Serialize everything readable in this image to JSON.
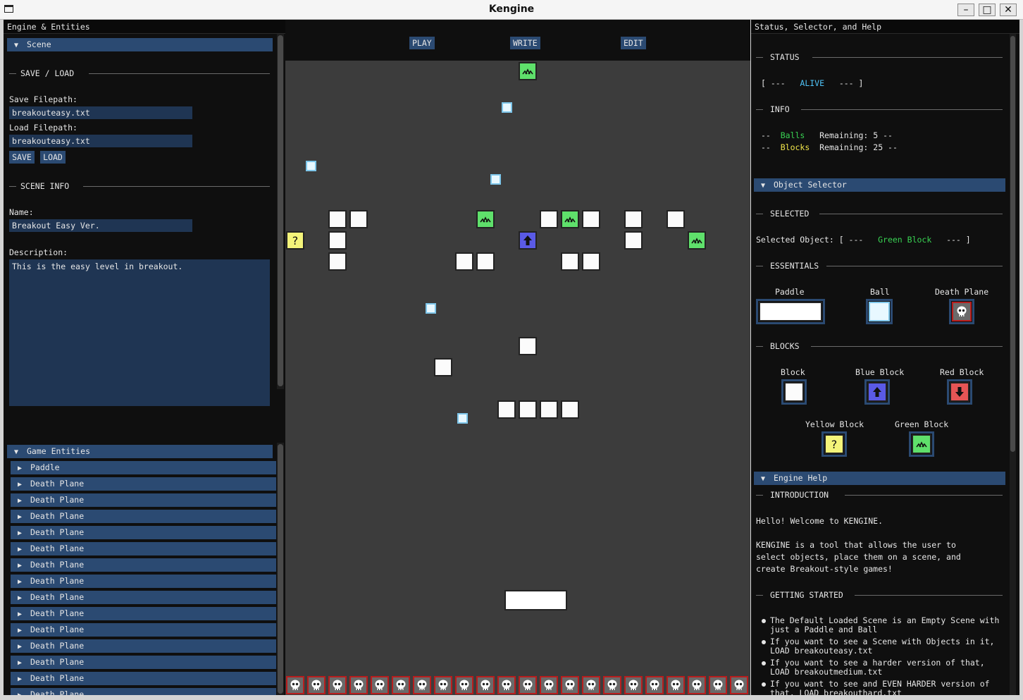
{
  "window": {
    "title": "Kengine"
  },
  "left": {
    "title": "Engine & Entities",
    "scene_header": "Scene",
    "save_load_sep": "SAVE / LOAD",
    "save_label": "Save Filepath:",
    "save_value": "breakouteasy.txt",
    "load_label": "Load Filepath:",
    "load_value": "breakouteasy.txt",
    "save_btn": "SAVE",
    "load_btn": "LOAD",
    "scene_info_sep": "SCENE INFO",
    "name_label": "Name:",
    "name_value": "Breakout Easy Ver.",
    "desc_label": "Description:",
    "desc_value": "This is the easy level in breakout.",
    "entities_header": "Game Entities",
    "entities": [
      "Paddle",
      "Death Plane",
      "Death Plane",
      "Death Plane",
      "Death Plane",
      "Death Plane",
      "Death Plane",
      "Death Plane",
      "Death Plane",
      "Death Plane",
      "Death Plane",
      "Death Plane",
      "Death Plane",
      "Death Plane",
      "Death Plane"
    ]
  },
  "center": {
    "play": "PLAY",
    "write": "WRITE",
    "edit": "EDIT"
  },
  "right": {
    "title": "Status, Selector, and Help",
    "status_sep": "STATUS",
    "status_open": "[ ---",
    "status_value": "ALIVE",
    "status_close": "--- ]",
    "info_sep": "INFO",
    "balls_prefix": "--",
    "balls_word": "Balls",
    "balls_rest": "Remaining: 5 --",
    "blocks_prefix": "--",
    "blocks_word": "Blocks",
    "blocks_rest": "Remaining: 25 --",
    "selector_header": "Object Selector",
    "selected_sep": "SELECTED",
    "selected_label": "Selected Object: [ ---",
    "selected_value": "Green Block",
    "selected_close": "--- ]",
    "essentials_sep": "ESSENTIALS",
    "paddle_label": "Paddle",
    "ball_label": "Ball",
    "death_label": "Death Plane",
    "blocks_sep": "BLOCKS",
    "block_label": "Block",
    "blue_label": "Blue Block",
    "red_label": "Red Block",
    "yellow_label": "Yellow Block",
    "green_label": "Green Block",
    "help_header": "Engine Help",
    "intro_sep": "INTRODUCTION",
    "intro1": "Hello! Welcome to KENGINE.",
    "intro2a": "KENGINE is a tool that allows the user to",
    "intro2b": "select objects, place them on a scene, and",
    "intro2c": "create Breakout-style games!",
    "started_sep": "GETTING STARTED",
    "b1a": "The Default Loaded Scene is an Empty Scene with",
    "b1b": "just a Paddle and Ball",
    "b2a": "If you want to see a Scene with Objects in it,",
    "b2b": "LOAD breakouteasy.txt",
    "b3a": "If you want to see a harder version of that,",
    "b3b": "LOAD breakoutmedium.txt",
    "b4a": "If you want to see and EVEN HARDER version of",
    "b4b": "that, LOAD breakouthard.txt"
  },
  "colors": {
    "accent": "#2b4a72",
    "alive": "#4fc3f7",
    "green_text": "#39d353",
    "yellow_text": "#f0e44a"
  }
}
